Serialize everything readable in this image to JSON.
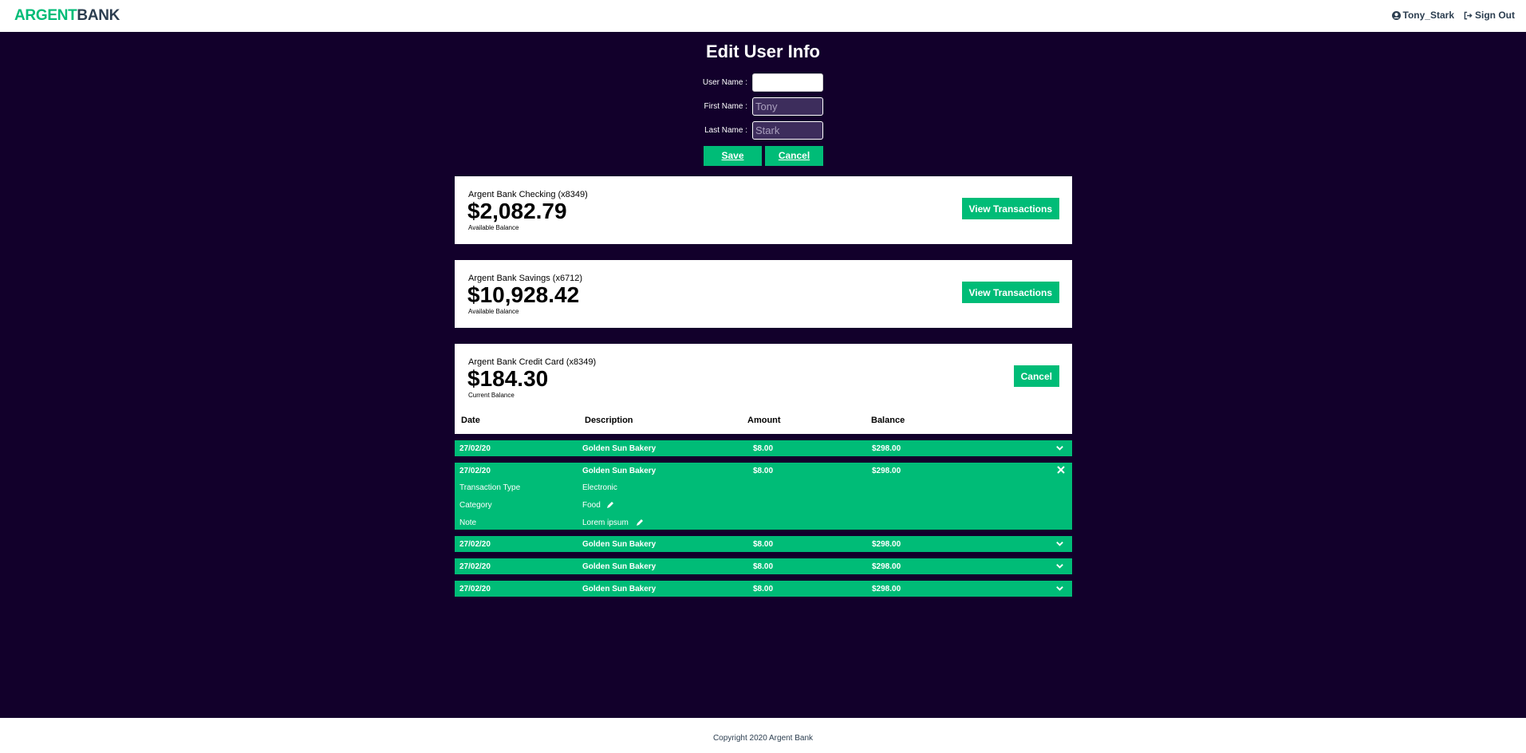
{
  "nav": {
    "logo_part1": "ARGENT",
    "logo_part2": "BANK",
    "user_name": "Tony_Stark",
    "sign_out": "Sign Out",
    "user_icon": "user-circle-icon",
    "signout_icon": "sign-out-icon"
  },
  "edit": {
    "title": "Edit User Info",
    "user_name_label": "User Name :",
    "user_name_value": "",
    "first_name_label": "First Name :",
    "first_name_value": "Tony",
    "last_name_label": "Last Name :",
    "last_name_value": "Stark",
    "save_label": "Save",
    "cancel_label": "Cancel"
  },
  "accounts": [
    {
      "title": "Argent Bank Checking (x8349)",
      "amount": "$2,082.79",
      "description": "Available Balance",
      "button": "View Transactions"
    },
    {
      "title": "Argent Bank Savings (x6712)",
      "amount": "$10,928.42",
      "description": "Available Balance",
      "button": "View Transactions"
    },
    {
      "title": "Argent Bank Credit Card (x8349)",
      "amount": "$184.30",
      "description": "Current Balance",
      "button": "Cancel"
    }
  ],
  "table": {
    "headers": [
      "Date",
      "Description",
      "Amount",
      "Balance"
    ],
    "rows": [
      {
        "date": "27/02/20",
        "description": "Golden Sun Bakery",
        "amount": "$8.00",
        "balance": "$298.00"
      },
      {
        "date": "27/02/20",
        "description": "Golden Sun Bakery",
        "amount": "$8.00",
        "balance": "$298.00"
      },
      {
        "date": "27/02/20",
        "description": "Golden Sun Bakery",
        "amount": "$8.00",
        "balance": "$298.00"
      },
      {
        "date": "27/02/20",
        "description": "Golden Sun Bakery",
        "amount": "$8.00",
        "balance": "$298.00"
      },
      {
        "date": "27/02/20",
        "description": "Golden Sun Bakery",
        "amount": "$8.00",
        "balance": "$298.00"
      }
    ],
    "details": {
      "type_label": "Transaction Type",
      "type_value": "Electronic",
      "category_label": "Category",
      "category_value": "Food",
      "note_label": "Note",
      "note_value": "Lorem ipsum"
    }
  },
  "footer": {
    "copyright": "Copyright 2020 Argent Bank"
  },
  "colors": {
    "accent": "#00bc77",
    "background": "#12002b",
    "text": "#2c3e50"
  }
}
